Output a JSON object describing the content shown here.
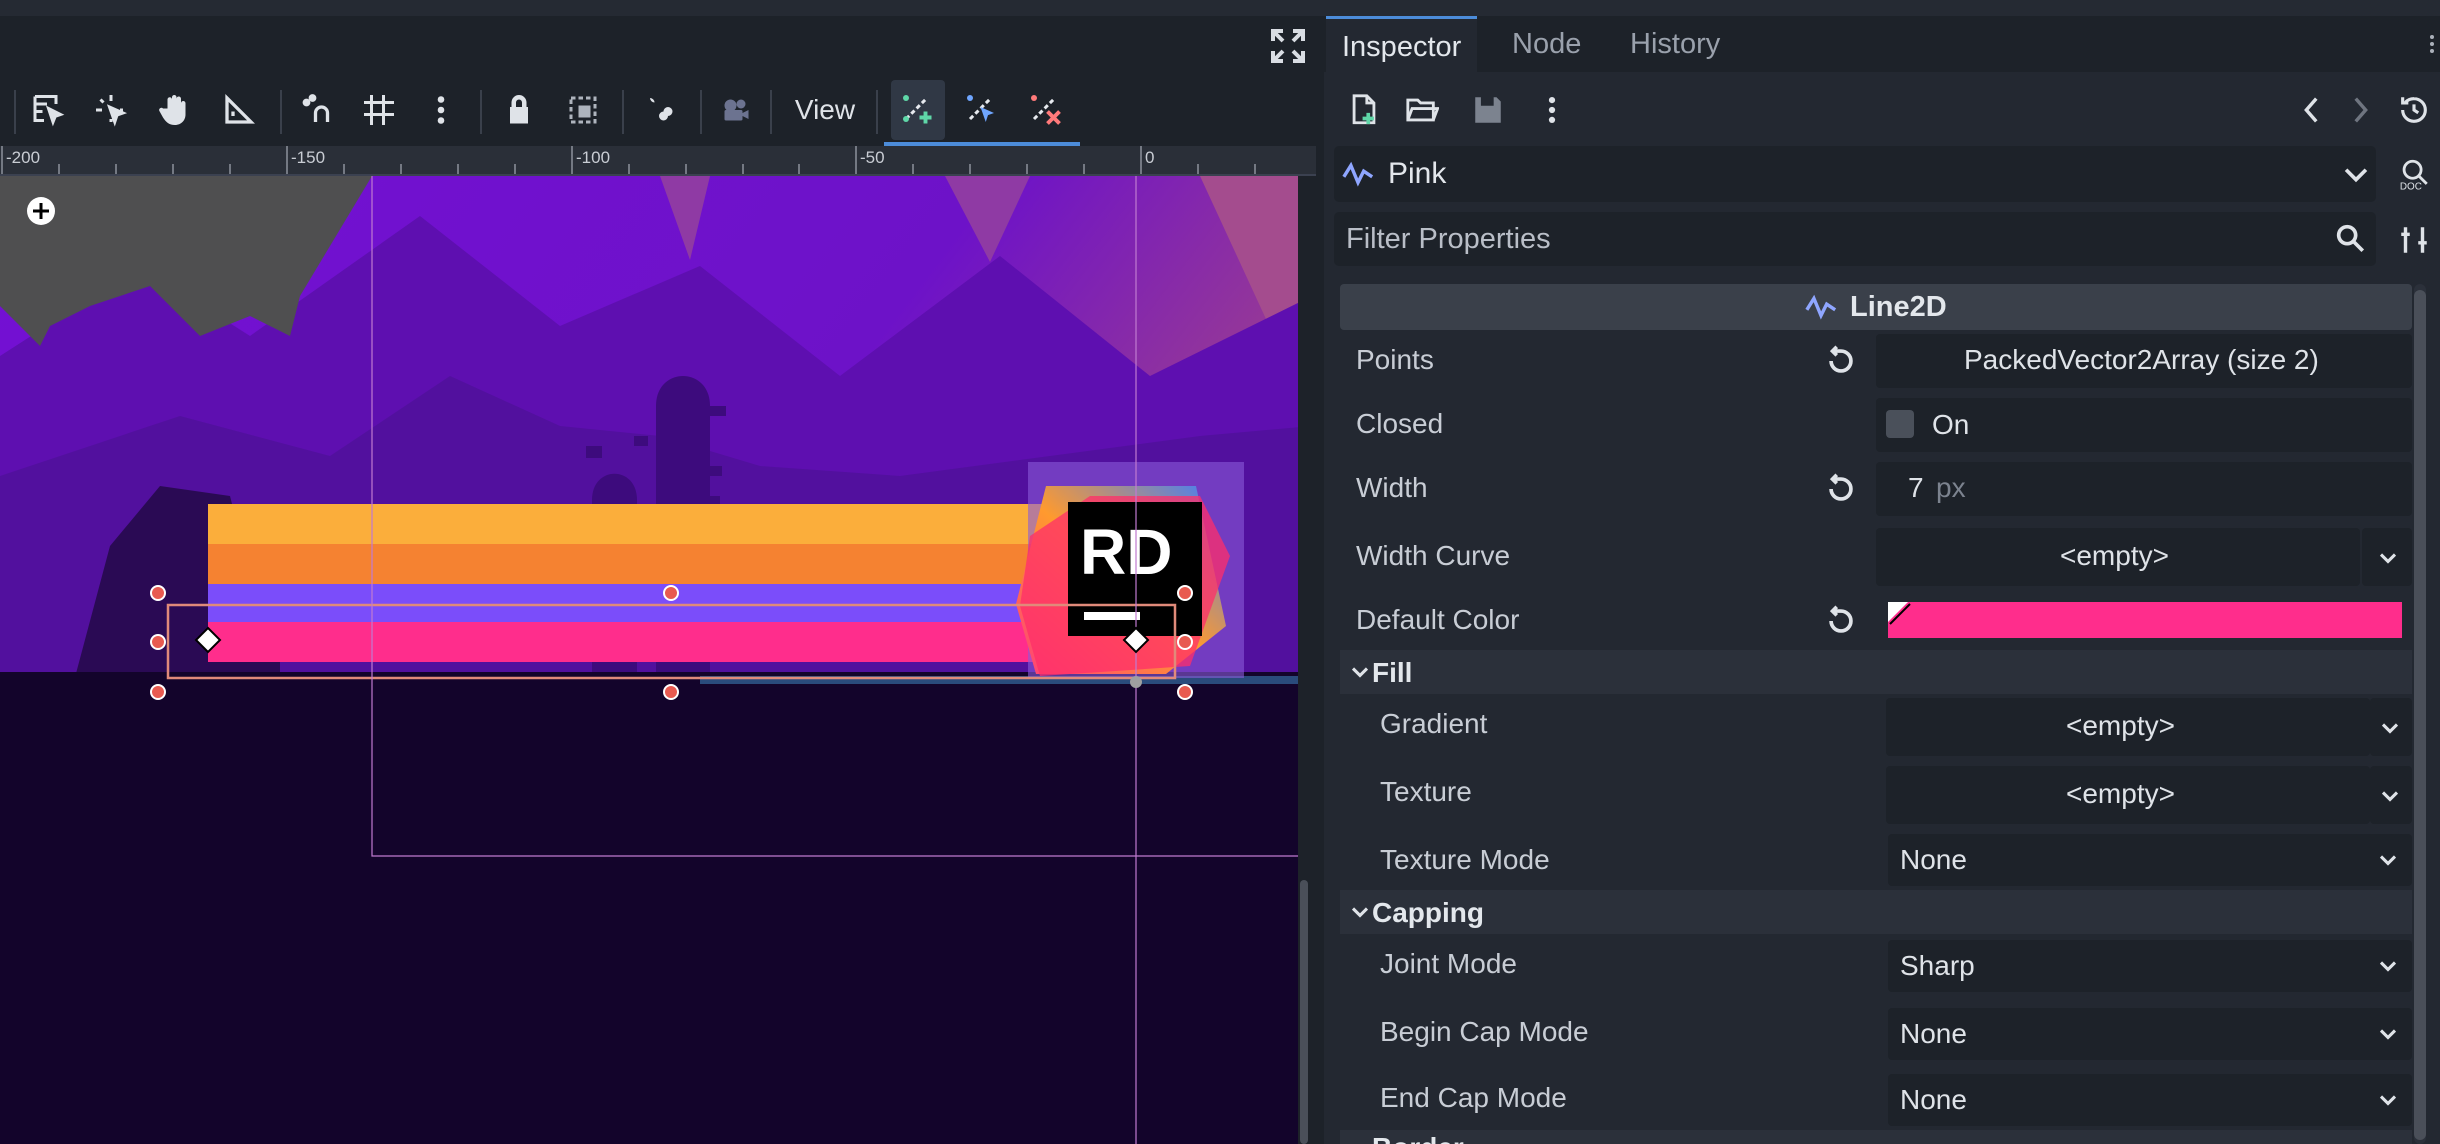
{
  "viewport": {
    "view_label": "View",
    "ruler_labels": [
      "-200",
      "-150",
      "-100",
      "-50",
      "0"
    ]
  },
  "inspector": {
    "tabs": [
      "Inspector",
      "Node",
      "History"
    ],
    "node_name": "Pink",
    "filter_placeholder": "Filter Properties",
    "class_name": "Line2D",
    "props": {
      "points": {
        "label": "Points",
        "value": "PackedVector2Array (size 2)"
      },
      "closed": {
        "label": "Closed",
        "value": "On"
      },
      "width": {
        "label": "Width",
        "value": "7",
        "unit": "px"
      },
      "width_curve": {
        "label": "Width Curve",
        "value": "<empty>"
      },
      "default_color": {
        "label": "Default Color",
        "color": "#ff2d8c"
      }
    },
    "sections": {
      "fill": {
        "title": "Fill",
        "gradient": {
          "label": "Gradient",
          "value": "<empty>"
        },
        "texture": {
          "label": "Texture",
          "value": "<empty>"
        },
        "texture_mode": {
          "label": "Texture Mode",
          "value": "None"
        }
      },
      "capping": {
        "title": "Capping",
        "joint_mode": {
          "label": "Joint Mode",
          "value": "Sharp"
        },
        "begin_cap": {
          "label": "Begin Cap Mode",
          "value": "None"
        },
        "end_cap": {
          "label": "End Cap Mode",
          "value": "None"
        }
      },
      "border": {
        "title": "Border"
      }
    }
  },
  "colors": {
    "accent": "#4c8cd9",
    "line_pink": "#ff2d8c",
    "stripe_yellow": "#fbae3b",
    "stripe_orange": "#f58231",
    "stripe_purple": "#7b4dfa",
    "bg_purple": "#6a12c8"
  },
  "logo_text": "RD"
}
